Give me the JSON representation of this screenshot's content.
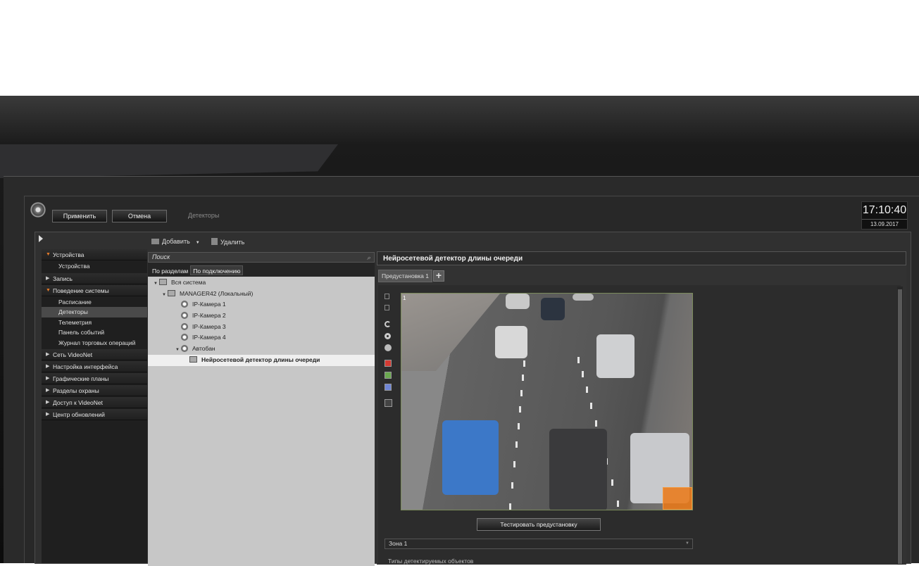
{
  "toolbar": {
    "apply_label": "Применить",
    "cancel_label": "Отмена",
    "breadcrumb": "Детекторы"
  },
  "clock": {
    "time": "17:10:40",
    "date": "13.09.2017"
  },
  "actions": {
    "add_label": "Добавить",
    "delete_label": "Удалить"
  },
  "sidebar": {
    "sections": [
      {
        "label": "Устройства",
        "open": true,
        "items": [
          {
            "label": "Устройства",
            "selected": false
          }
        ]
      },
      {
        "label": "Запись",
        "open": false,
        "items": []
      },
      {
        "label": "Поведение системы",
        "open": true,
        "items": [
          {
            "label": "Расписание",
            "selected": false
          },
          {
            "label": "Детекторы",
            "selected": true
          },
          {
            "label": "Телеметрия",
            "selected": false
          },
          {
            "label": "Панель событий",
            "selected": false
          },
          {
            "label": "Журнал торговых операций",
            "selected": false
          }
        ]
      },
      {
        "label": "Сеть VideoNet",
        "open": false,
        "items": []
      },
      {
        "label": "Настройка интерфейса",
        "open": false,
        "items": []
      },
      {
        "label": "Графические планы",
        "open": false,
        "items": []
      },
      {
        "label": "Разделы охраны",
        "open": false,
        "items": []
      },
      {
        "label": "Доступ к VideoNet",
        "open": false,
        "items": []
      },
      {
        "label": "Центр обновлений",
        "open": false,
        "items": []
      }
    ]
  },
  "tree": {
    "search_placeholder": "Поиск",
    "tabs": [
      {
        "label": "По разделам",
        "selected": false
      },
      {
        "label": "По подключению",
        "selected": true
      }
    ],
    "nodes": [
      {
        "label": "Вся система",
        "level": 0,
        "expander": "▼",
        "icon": "system-icon"
      },
      {
        "label": "MANAGER42 (Локальный)",
        "level": 1,
        "expander": "▼",
        "icon": "monitor-icon"
      },
      {
        "label": "IP-Камера 1",
        "level": 2,
        "expander": "",
        "icon": "camera-icon"
      },
      {
        "label": "IP-Камера 2",
        "level": 2,
        "expander": "",
        "icon": "camera-icon"
      },
      {
        "label": "IP-Камера 3",
        "level": 2,
        "expander": "",
        "icon": "camera-icon"
      },
      {
        "label": "IP-Камера 4",
        "level": 2,
        "expander": "",
        "icon": "camera-icon"
      },
      {
        "label": "Автобан",
        "level": 2,
        "expander": "▼",
        "icon": "camera-icon"
      },
      {
        "label": "Нейросетевой детектор длины очереди",
        "level": 3,
        "expander": "",
        "icon": "detector-icon",
        "selected": true
      }
    ]
  },
  "detector": {
    "title": "Нейросетевой детектор длины очереди",
    "preset_tab": "Предустановка 1",
    "video_channel": "1",
    "test_button": "Тестировать предустановку",
    "zone_value": "Зона 1",
    "types_label": "Типы детектируемых объектов"
  },
  "colors": {
    "accent": "#e37a2a",
    "zone": "#eb7814",
    "tool_red": "#d43a32",
    "tool_green": "#6aa84f",
    "tool_blue": "#6f86d6"
  }
}
